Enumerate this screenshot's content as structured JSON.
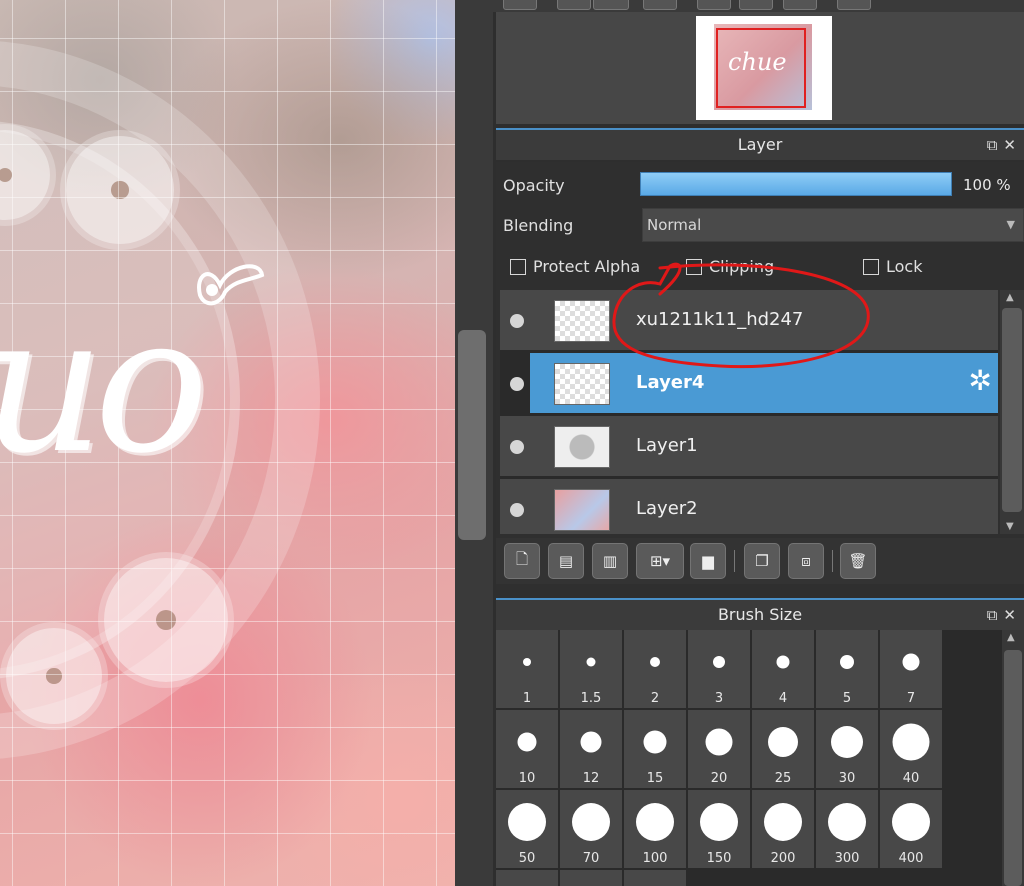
{
  "navigator": {
    "thumbnail_text": "chue"
  },
  "layer_panel": {
    "title": "Layer",
    "opacity_label": "Opacity",
    "opacity_value": "100 %",
    "opacity_fraction": 1.0,
    "blending_label": "Blending",
    "blending_value": "Normal",
    "checkboxes": {
      "protect_alpha": "Protect Alpha",
      "clipping": "Clipping",
      "lock": "Lock"
    },
    "layers": [
      {
        "name": "xu1211k11_hd247",
        "selected": false
      },
      {
        "name": "Layer4",
        "selected": true
      },
      {
        "name": "Layer1",
        "selected": false
      },
      {
        "name": "Layer2",
        "selected": false
      }
    ]
  },
  "brush_panel": {
    "title": "Brush Size",
    "sizes": [
      "1",
      "1.5",
      "2",
      "3",
      "4",
      "5",
      "7",
      "10",
      "12",
      "15",
      "20",
      "25",
      "30",
      "40",
      "50",
      "70",
      "100",
      "150",
      "200",
      "300",
      "400"
    ]
  },
  "colors": {
    "accent": "#4a9ad4",
    "annotation": "#e01818",
    "opacity_bar": "#5aa9e6"
  }
}
